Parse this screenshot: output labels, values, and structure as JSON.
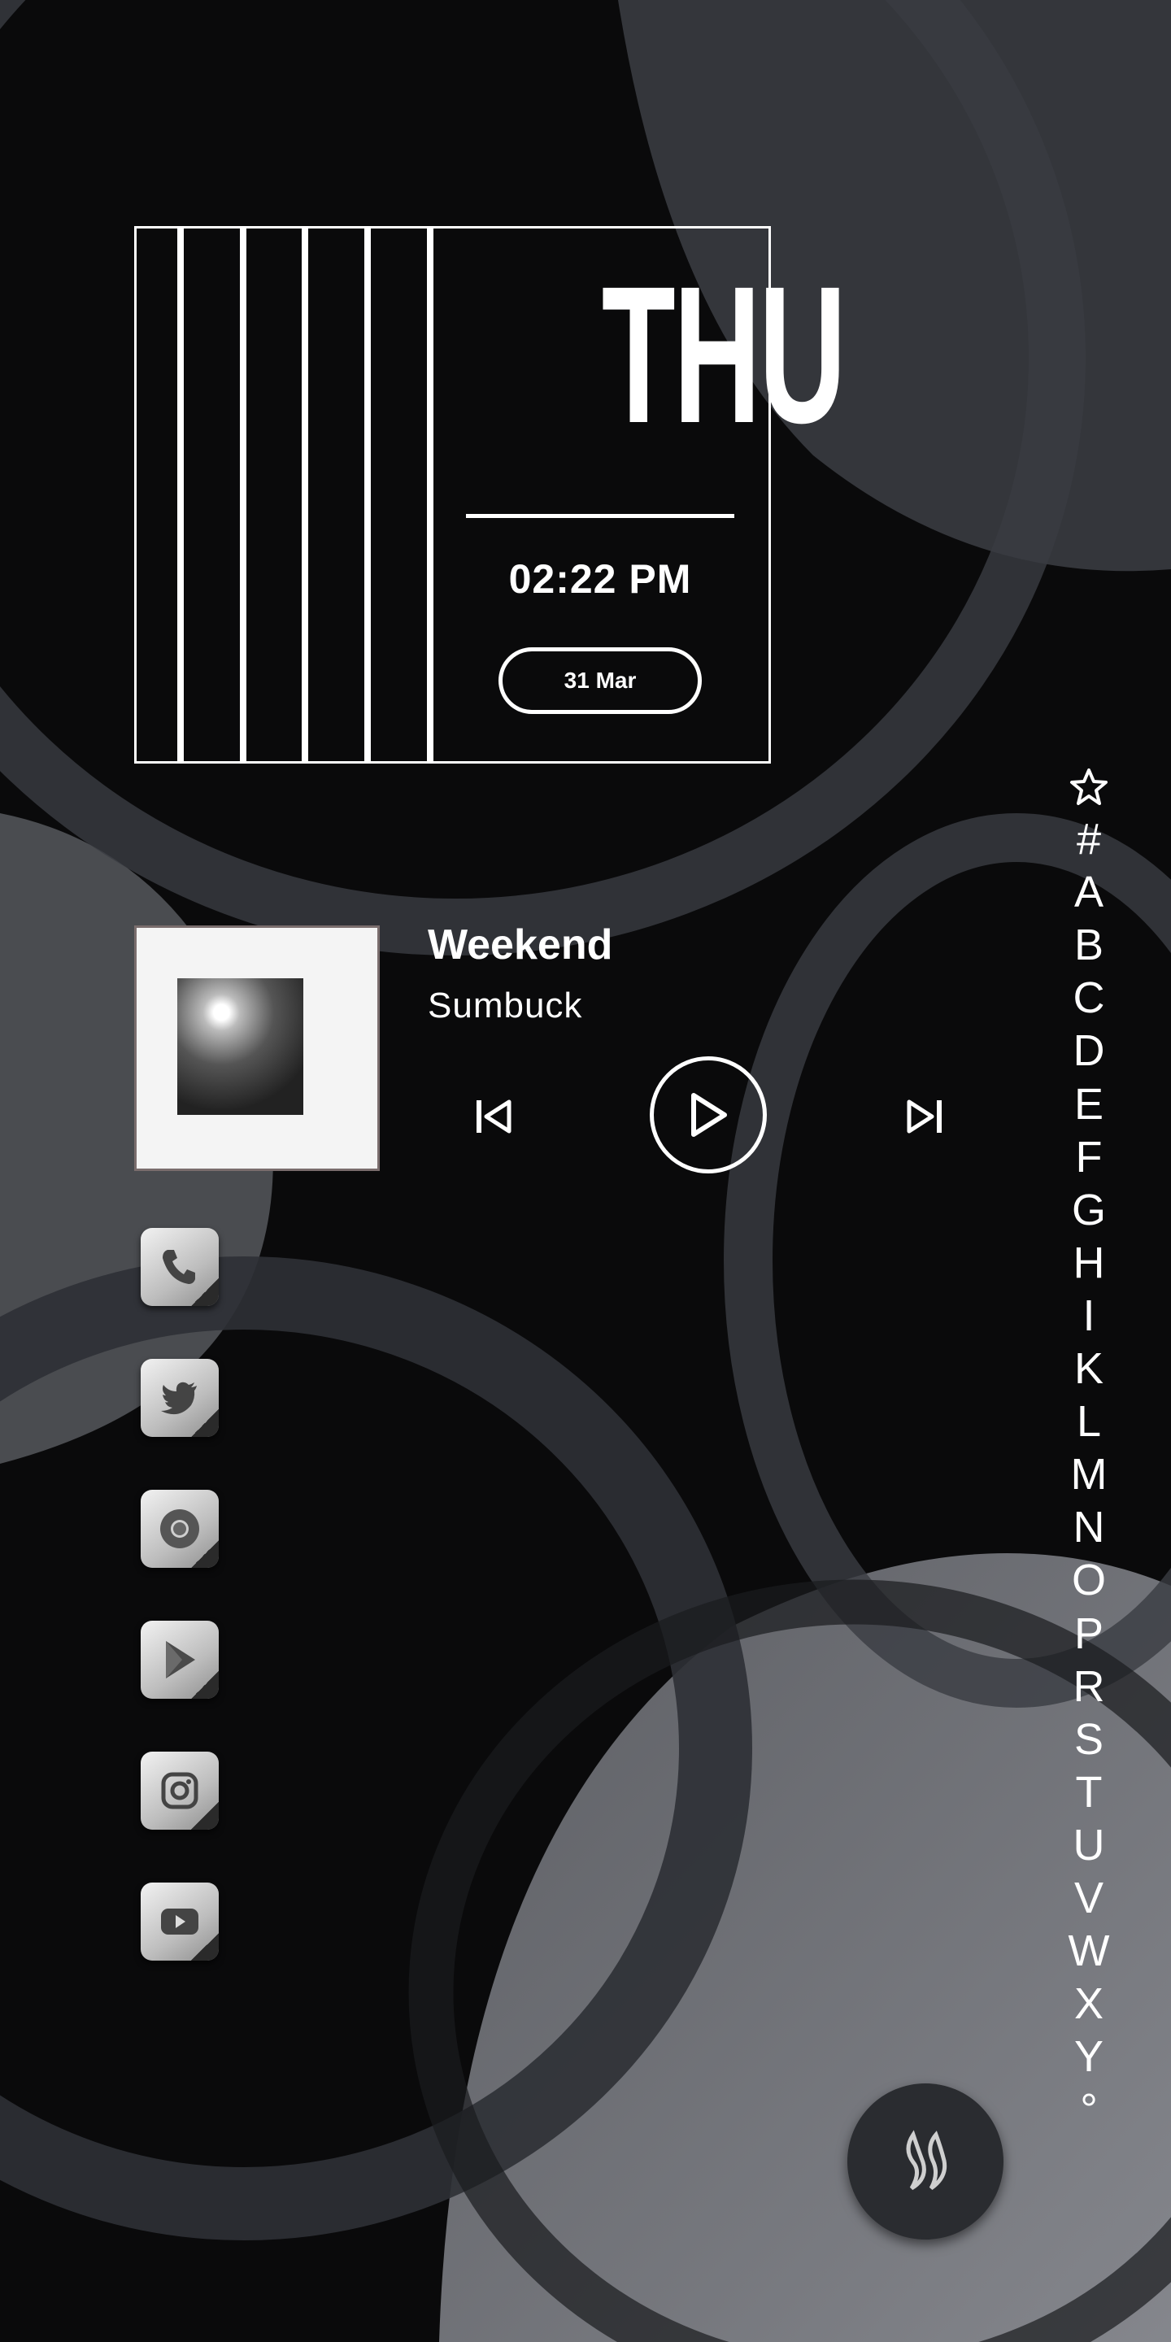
{
  "clock": {
    "day": "THU",
    "time": "02:22 PM",
    "date": "31 Mar"
  },
  "music": {
    "title": "Weekend",
    "artist": "Sumbuck"
  },
  "dock": [
    {
      "name": "phone",
      "icon": "phone-icon"
    },
    {
      "name": "twitter",
      "icon": "twitter-icon"
    },
    {
      "name": "chrome",
      "icon": "chrome-icon"
    },
    {
      "name": "play-store",
      "icon": "play-store-icon"
    },
    {
      "name": "instagram",
      "icon": "instagram-icon"
    },
    {
      "name": "youtube",
      "icon": "youtube-icon"
    }
  ],
  "index": [
    "#",
    "A",
    "B",
    "C",
    "D",
    "E",
    "F",
    "G",
    "H",
    "I",
    "K",
    "L",
    "M",
    "N",
    "O",
    "P",
    "R",
    "S",
    "T",
    "U",
    "V",
    "W",
    "X",
    "Y",
    "°"
  ],
  "colors": {
    "background": "#0a0a0b",
    "foreground": "#ffffff",
    "fab": "#2a2c30"
  }
}
